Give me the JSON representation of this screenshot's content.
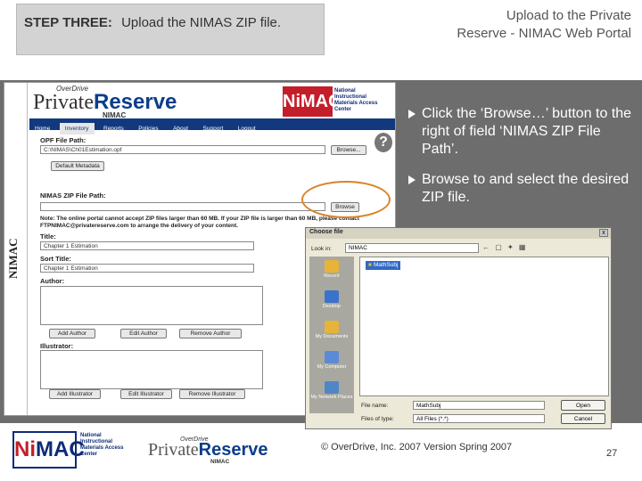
{
  "header": {
    "step_label": "STEP THREE:",
    "step_text": "Upload the NIMAS ZIP file.",
    "title_line1": "Upload to the Private",
    "title_line2": "Reserve - NIMAC Web Portal"
  },
  "portal": {
    "side_label": "NIMAC",
    "logo_small": "OverDrive",
    "logo_private": "Private",
    "logo_reserve": "Reserve",
    "logo_sub": "NIMAC",
    "nimac_logo": "NiMAC",
    "nimac_logo_text": "National Instructional Materials Access Center",
    "nav": [
      "Home",
      "Inventory",
      "Reports",
      "Policies",
      "About",
      "Support",
      "Logout"
    ],
    "opf_label": "OPF File Path:",
    "opf_value": "C:\\NIMAS\\Ch01Estimation.opf",
    "browse_label": "Browse...",
    "default_metadata": "Default Metadata",
    "zip_label": "NIMAS ZIP File Path:",
    "zip_browse": "Browse",
    "note": "Note: The online portal cannot accept ZIP files larger than 60 MB. If your ZIP file is larger than 60 MB, please contact FTPNIMAC@privatereserve.com to arrange the delivery of your content.",
    "title_label": "Title:",
    "title_value": "Chapter 1 Estimation",
    "sort_title_label": "Sort Title:",
    "sort_title_value": "Chapter 1 Estimation",
    "author_label": "Author:",
    "add_author": "Add Author",
    "edit_author": "Edit Author",
    "remove_author": "Remove Author",
    "illustrator_label": "Illustrator:",
    "add_illustrator": "Add Illustrator",
    "edit_illustrator": "Edit Illustrator",
    "remove_illustrator": "Remove Illustrator",
    "help": "?"
  },
  "dialog": {
    "title": "Choose file",
    "close": "x",
    "look_in_label": "Look in:",
    "look_in_value": "NIMAC",
    "tools": "← ▢ ✦ ▦",
    "places": [
      "Recent",
      "Desktop",
      "My Documents",
      "My Computer",
      "My Network Places"
    ],
    "selected_item": "MathSubj",
    "file_name_label": "File name:",
    "file_name_value": "MathSubj",
    "file_type_label": "Files of type:",
    "file_type_value": "All Files (*.*)",
    "open_button": "Open",
    "cancel_button": "Cancel"
  },
  "bullets": [
    "Click the ‘Browse…’ button to the right of field ‘NIMAS ZIP File Path’.",
    "Browse to and select the desired ZIP file."
  ],
  "footer": {
    "nimac_logo_ni": "Ni",
    "nimac_logo_mac": "MAC",
    "nimac_logo_text": "National Instructional Materials Access Center",
    "pr_small": "OverDrive",
    "pr_private": "Private",
    "pr_reserve": "Reserve",
    "pr_sub": "NIMAC",
    "copyright": "© OverDrive, Inc. 2007   Version Spring 2007",
    "page_number": "27"
  },
  "colors": {
    "band": "#6d6d6d",
    "nav": "#12397e",
    "nimac_red": "#c41e2a",
    "highlight": "#d9822b"
  }
}
